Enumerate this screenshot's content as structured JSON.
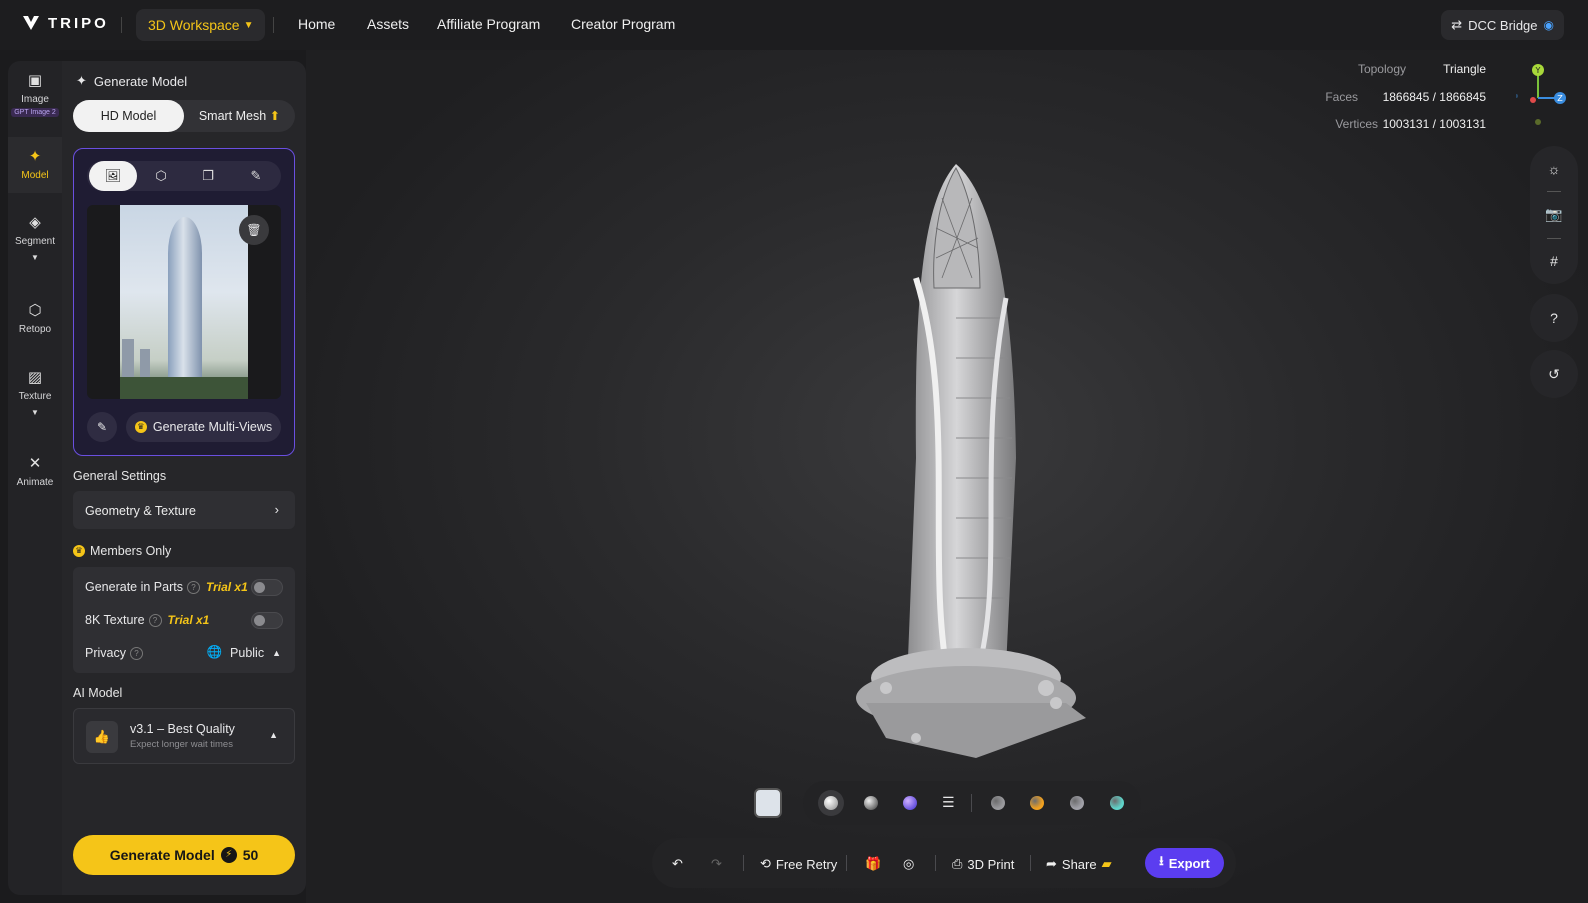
{
  "topbar": {
    "logo_text": "TRIPO",
    "workspace_label": "3D Workspace",
    "nav": [
      "Home",
      "Assets",
      "Affiliate Program",
      "Creator Program"
    ],
    "dcc_label": "DCC Bridge"
  },
  "rail": {
    "items": [
      {
        "label": "Image",
        "badge": "GPT Image 2",
        "icon": "image-icon"
      },
      {
        "label": "Model",
        "icon": "sparkle-icon"
      },
      {
        "label": "Segment",
        "icon": "cube-split-icon"
      },
      {
        "label": "Retopo",
        "icon": "mesh-icon"
      },
      {
        "label": "Texture",
        "icon": "texture-icon"
      },
      {
        "label": "Animate",
        "icon": "figure-icon"
      }
    ]
  },
  "panel": {
    "title": "Generate Model",
    "mode_hd": "HD Model",
    "mode_smart": "Smart Mesh",
    "multiview_label": "Generate Multi-Views",
    "general_settings": "General Settings",
    "geometry_texture": "Geometry & Texture",
    "members_only": "Members Only",
    "parts_label": "Generate in Parts",
    "parts_trial": "Trial x1",
    "texture8k_label": "8K Texture",
    "texture8k_trial": "Trial x1",
    "privacy_label": "Privacy",
    "privacy_value": "Public",
    "ai_model_label": "AI Model",
    "ai_model_name": "v3.1 – Best Quality",
    "ai_model_sub": "Expect longer wait times",
    "generate_label": "Generate Model",
    "generate_cost": "50"
  },
  "stats": {
    "topology_label": "Topology",
    "topology_value": "Triangle",
    "faces_label": "Faces",
    "faces_value": "1866845 / 1866845",
    "vertices_label": "Vertices",
    "vertices_value": "1003131 / 1003131"
  },
  "axis": {
    "y": "Y",
    "z": "Z"
  },
  "right_tools": {
    "help": "?"
  },
  "materials": {
    "swatches": [
      "#9a9a9e",
      "#f0a020",
      "#a0a0a8",
      "#5fd3c9"
    ]
  },
  "actions": {
    "free_retry": "Free Retry",
    "print": "3D Print",
    "share": "Share",
    "export": "Export"
  }
}
